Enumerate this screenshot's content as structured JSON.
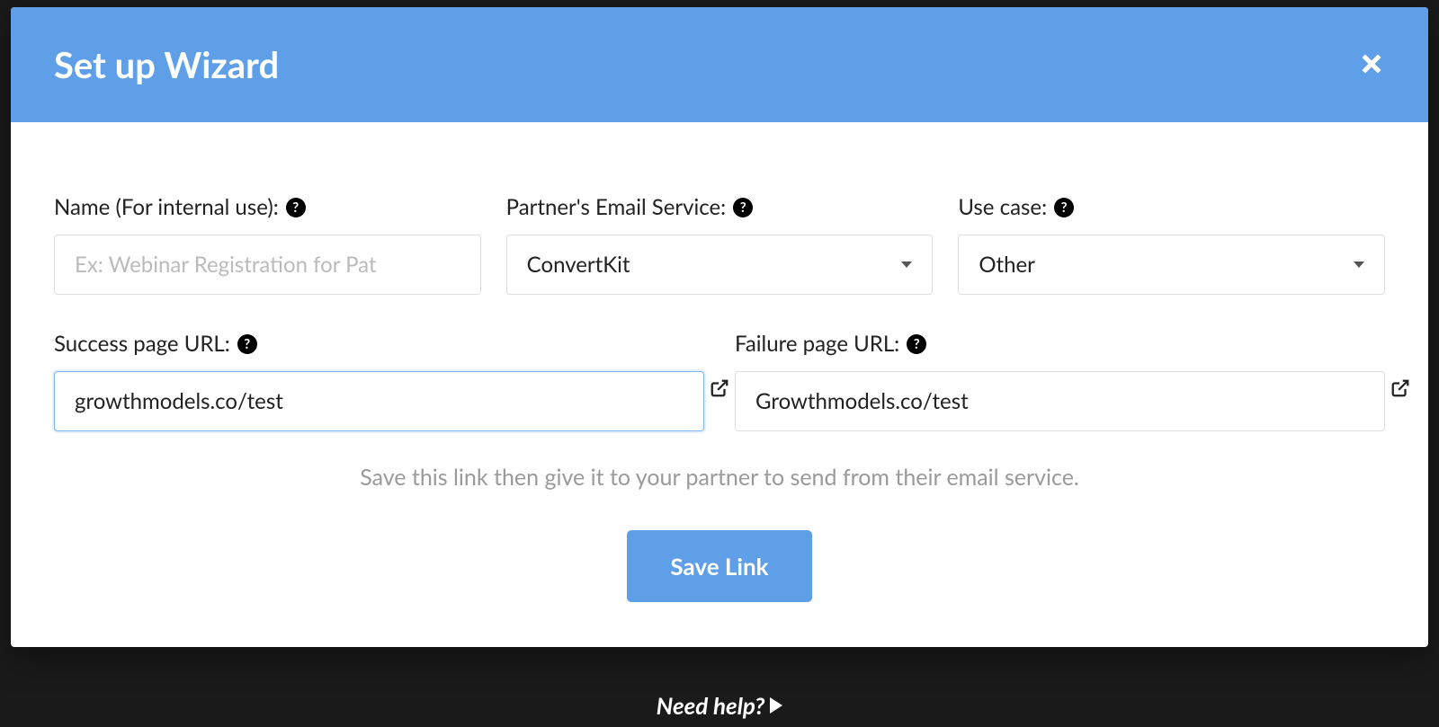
{
  "modal": {
    "title": "Set up Wizard"
  },
  "form": {
    "name": {
      "label": "Name (For internal use):",
      "placeholder": "Ex: Webinar Registration for Pat",
      "value": ""
    },
    "emailService": {
      "label": "Partner's Email Service:",
      "selected": "ConvertKit"
    },
    "useCase": {
      "label": "Use case:",
      "selected": "Other"
    },
    "successUrl": {
      "label": "Success page URL:",
      "value": "growthmodels.co/test"
    },
    "failureUrl": {
      "label": "Failure page URL:",
      "value": "Growthmodels.co/test"
    },
    "helperText": "Save this link then give it to your partner to send from their email service.",
    "saveButton": "Save Link"
  },
  "helpBar": {
    "text": "Need help?"
  }
}
